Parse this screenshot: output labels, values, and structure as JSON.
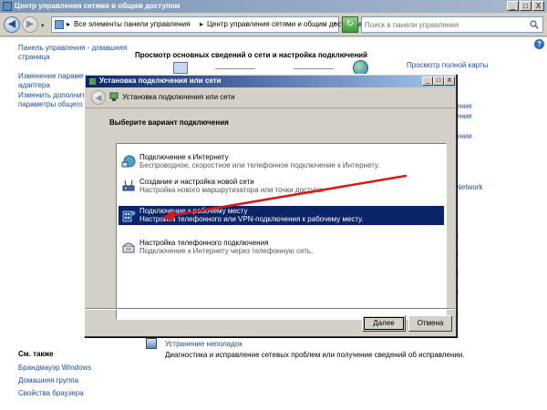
{
  "window": {
    "title": "Центр управления сетями и общим доступом",
    "controls": {
      "minimize": "_",
      "maximize": "□",
      "close": "X"
    }
  },
  "address": {
    "crumbs": [
      "▸",
      "Все элементы панели управления",
      "▸",
      "Центр управления сетями и общим доступом"
    ],
    "search_placeholder": "Поиск в панели управления"
  },
  "left_panel": {
    "links": [
      {
        "label": "Панель управления - домашняя",
        "label2": "страница"
      },
      {
        "label": "Изменение параметров",
        "label2": "адаптера"
      },
      {
        "label": "Изменить дополнитель",
        "label2": "параметры общего до"
      }
    ],
    "see_also_title": "См. также",
    "see_also": [
      "Брандмауэр Windows",
      "Домашняя группа",
      "Свойства браузера"
    ]
  },
  "main": {
    "heading": "Просмотр основных сведений о сети и настройка подключений",
    "view_map": "Просмотр полной карты",
    "right_partials": [
      "ение",
      "ение",
      "ение",
      "Network"
    ],
    "troubleshoot": {
      "link": "Устранение неполадок",
      "desc": "Диагностика и исправление сетевых проблем или получение сведений об исправлении."
    }
  },
  "dialog": {
    "title": "Установка подключения или сети",
    "header_title": "Установка подключения или сети",
    "choose_label": "Выберите вариант подключения",
    "options": [
      {
        "title": "Подключение к Интернету",
        "desc": "Беспроводное, скоростное или телефонное подключение к Интернету.",
        "icon": "globe-network-icon",
        "selected": false
      },
      {
        "title": "Создание и настройка новой сети",
        "desc": "Настройка нового маршрутизатора или точки доступа.",
        "icon": "router-network-icon",
        "selected": false
      },
      {
        "title": "Подключение к рабочему месту",
        "desc": "Настройка телефонного или VPN-подключения к рабочему месту.",
        "icon": "workplace-vpn-icon",
        "selected": true
      },
      {
        "title": "Настройка телефонного подключения",
        "desc": "Подключение к Интернету через телефонную сеть.",
        "icon": "dialup-phone-icon",
        "selected": false
      }
    ],
    "next_button": "Далее",
    "cancel_button": "Отмена"
  },
  "colors": {
    "selection": "#0a246a",
    "link": "#1a4fa0",
    "annotation_arrow": "#d41b1b"
  }
}
